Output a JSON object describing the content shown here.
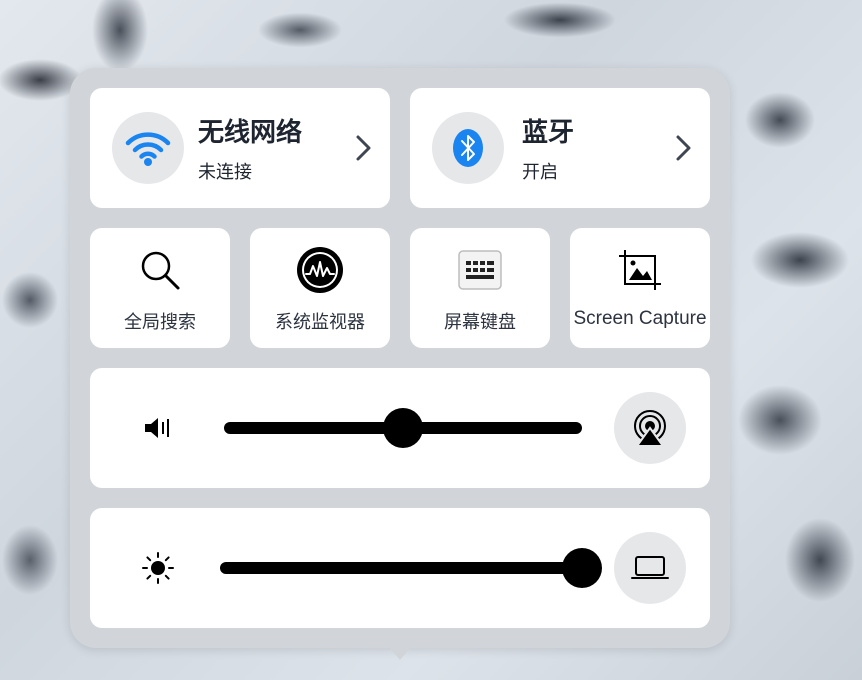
{
  "wifi": {
    "title": "无线网络",
    "status": "未连接",
    "icon": "wifi-icon",
    "accent": "#1a84f0"
  },
  "bluetooth": {
    "title": "蓝牙",
    "status": "开启",
    "icon": "bluetooth-icon",
    "accent": "#1a84f0"
  },
  "shortcuts": [
    {
      "label": "全局搜索",
      "icon": "search-icon"
    },
    {
      "label": "系统监视器",
      "icon": "system-monitor-icon"
    },
    {
      "label": "屏幕键盘",
      "icon": "keyboard-icon"
    },
    {
      "label": "Screen Capture",
      "icon": "screen-capture-icon"
    }
  ],
  "volume": {
    "level": 0.5,
    "left_icon": "volume-icon",
    "right_icon": "audio-output-icon"
  },
  "brightness": {
    "level": 1.0,
    "left_icon": "brightness-icon",
    "right_icon": "display-icon"
  }
}
